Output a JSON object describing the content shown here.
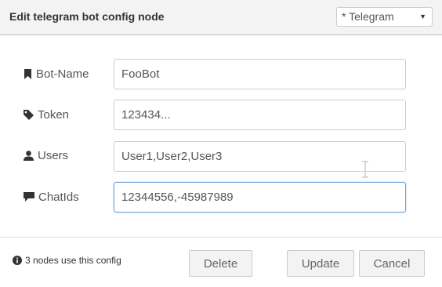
{
  "header": {
    "title": "Edit telegram bot config node",
    "config_select_value": "* Telegram",
    "caret_icon": "caret-down-icon"
  },
  "form": {
    "bot_name": {
      "label": "Bot-Name",
      "icon": "bookmark-icon",
      "value": "FooBot"
    },
    "token": {
      "label": "Token",
      "icon": "tag-icon",
      "value": "123434..."
    },
    "users": {
      "label": "Users",
      "icon": "user-icon",
      "value": "User1,User2,User3"
    },
    "chatids": {
      "label": "ChatIds",
      "icon": "comment-icon",
      "value": "12344556,-45987989"
    }
  },
  "footer": {
    "info_text": "3 nodes use this config",
    "info_icon": "info-circle-icon",
    "delete_label": "Delete",
    "update_label": "Update",
    "cancel_label": "Cancel"
  },
  "colors": {
    "header_bg": "#f3f3f3",
    "focus_border": "#6a9fd8",
    "button_bg": "#f3f3f3"
  }
}
